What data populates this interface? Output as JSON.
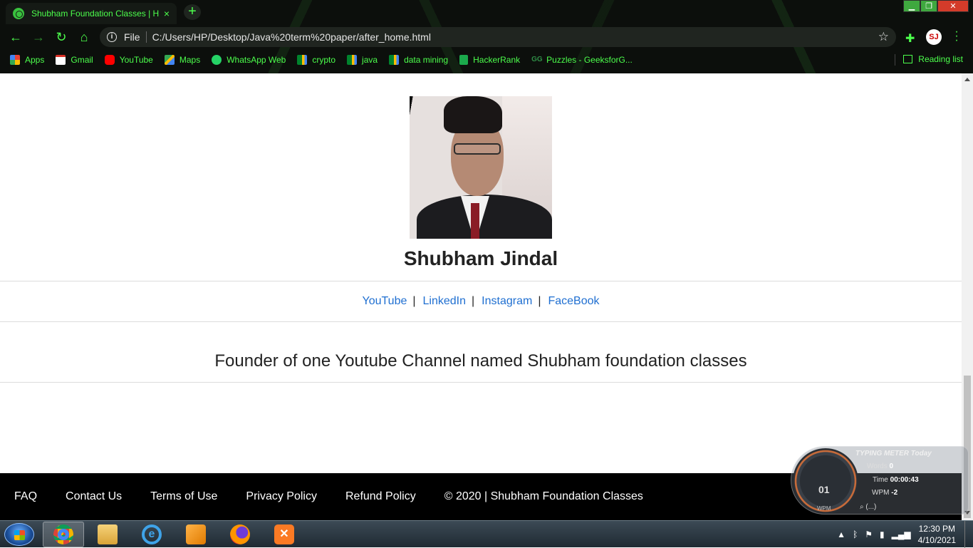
{
  "browser": {
    "tab_title": "Shubham Foundation Classes | H",
    "tab_close": "×",
    "new_tab": "+",
    "file_label": "File",
    "url": "C:/Users/HP/Desktop/Java%20term%20paper/after_home.html",
    "profile_initials": "SJ",
    "bookmarks": [
      {
        "label": "Apps",
        "icon": "apps-grid-icon",
        "color": "#e94235"
      },
      {
        "label": "Gmail",
        "icon": "gmail-icon",
        "color": "#d93025"
      },
      {
        "label": "YouTube",
        "icon": "youtube-icon",
        "color": "#ff0000"
      },
      {
        "label": "Maps",
        "icon": "maps-icon",
        "color": "#34a853"
      },
      {
        "label": "WhatsApp Web",
        "icon": "whatsapp-icon",
        "color": "#25d366"
      },
      {
        "label": "crypto",
        "icon": "meet-icon",
        "color": "#00832d"
      },
      {
        "label": "java",
        "icon": "meet-icon",
        "color": "#00832d"
      },
      {
        "label": "data mining",
        "icon": "meet-icon",
        "color": "#00832d"
      },
      {
        "label": "HackerRank",
        "icon": "hackerrank-icon",
        "color": "#1ba94c"
      },
      {
        "label": "Puzzles - GeeksforG...",
        "icon": "geeksforgeeks-icon",
        "color": "#2f8d46"
      }
    ],
    "reading_list": "Reading list"
  },
  "profile": {
    "name": "Shubham Jindal",
    "social": [
      "YouTube",
      "LinkedIn",
      "Instagram",
      "FaceBook"
    ],
    "separator": "|",
    "headline": "Founder of one Youtube Channel named Shubham foundation classes"
  },
  "footer": {
    "links": [
      "FAQ",
      "Contact Us",
      "Terms of Use",
      "Privacy Policy",
      "Refund Policy"
    ],
    "copyright": "© 2020 | Shubham Foundation Classes"
  },
  "typing_meter": {
    "title": "TYPING METER Today",
    "words_label": "Words",
    "words_value": "0",
    "time_label": "Time",
    "time_value": "00:00:43",
    "wpm_label": "WPM",
    "wpm_value": "-2",
    "gauge_value": "01",
    "gauge_unit": "WPM",
    "search_hint": "(...)"
  },
  "taskbar": {
    "time": "12:30 PM",
    "date": "4/10/2021"
  },
  "colors": {
    "chrome_accent": "#4cff4c",
    "link": "#1f6fd1",
    "footer_bg": "#000000"
  }
}
